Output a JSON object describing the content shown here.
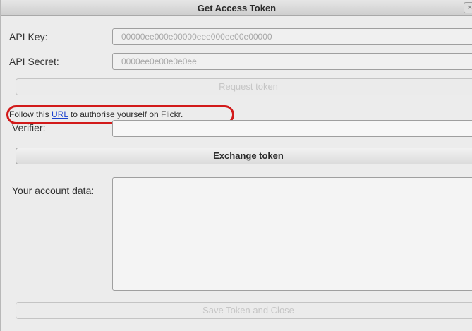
{
  "window": {
    "title": "Get Access Token",
    "close_glyph": "×"
  },
  "api_key": {
    "label": "API Key:",
    "value": "00000ee000e00000eee000ee00e00000"
  },
  "api_secret": {
    "label": "API Secret:",
    "value": "0000ee0e00e0e0ee"
  },
  "request_button": {
    "label": "Request token"
  },
  "follow": {
    "prefix": "Follow this ",
    "link": "URL",
    "suffix": " to authorise yourself on Flickr."
  },
  "verifier": {
    "label": "Verifier:",
    "value": ""
  },
  "exchange_button": {
    "label": "Exchange token"
  },
  "account": {
    "label": "Your account data:",
    "value": ""
  },
  "save_button": {
    "label": "Save Token and Close"
  },
  "colors": {
    "highlight": "#d21a1a",
    "link": "#1a3fcf"
  }
}
